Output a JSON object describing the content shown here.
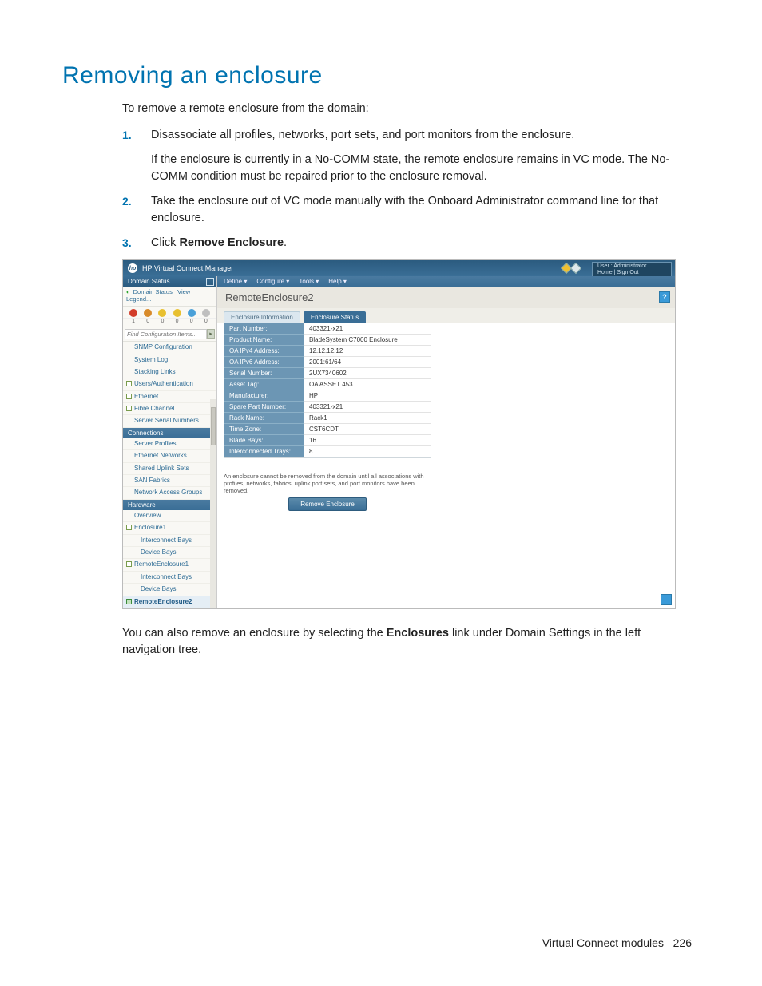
{
  "title": "Removing an enclosure",
  "intro": "To remove a remote enclosure from the domain:",
  "steps": {
    "s1a": "Disassociate all profiles, networks, port sets, and port monitors from the enclosure.",
    "s1b": "If the enclosure is currently in a No-COMM state, the remote enclosure remains in VC mode. The No-COMM condition must be repaired prior to the enclosure removal.",
    "s2": "Take the enclosure out of VC mode manually with the Onboard Administrator command line for that enclosure.",
    "s3_pre": "Click ",
    "s3_bold": "Remove Enclosure",
    "s3_post": "."
  },
  "after_pre": "You can also remove an enclosure by selecting the ",
  "after_bold": "Enclosures",
  "after_post": " link under Domain Settings in the left navigation tree.",
  "footer_label": "Virtual Connect modules",
  "footer_page": "226",
  "mock": {
    "topbar_title": "HP Virtual Connect Manager",
    "user_line1": "User : Administrator",
    "user_line2": "Home | Sign Out",
    "side": {
      "ds": "Domain Status",
      "legend1": "Domain Status",
      "legend2": "View Legend...",
      "counts": [
        "1",
        "0",
        "0",
        "0",
        "0",
        "0"
      ],
      "find_ph": "Find Configuration Items...",
      "items_top": [
        "SNMP Configuration",
        "System Log",
        "Stacking Links",
        "Users/Authentication",
        "Ethernet",
        "Fibre Channel",
        "Server Serial Numbers"
      ],
      "sect_conn": "Connections",
      "items_conn": [
        "Server Profiles",
        "Ethernet Networks",
        "Shared Uplink Sets",
        "SAN Fabrics",
        "Network Access Groups"
      ],
      "sect_hw": "Hardware",
      "items_hw": [
        "Overview",
        "Enclosure1",
        "Interconnect Bays",
        "Device Bays",
        "RemoteEnclosure1",
        "Interconnect Bays",
        "Device Bays",
        "RemoteEnclosure2"
      ]
    },
    "menus": [
      "Define ▾",
      "Configure ▾",
      "Tools ▾",
      "Help ▾"
    ],
    "heading": "RemoteEnclosure2",
    "tabs": {
      "t1": "Enclosure Information",
      "t2": "Enclosure Status"
    },
    "props": [
      {
        "k": "Part Number:",
        "v": "403321-x21"
      },
      {
        "k": "Product Name:",
        "v": "BladeSystem C7000 Enclosure"
      },
      {
        "k": "OA IPv4 Address:",
        "v": "12.12.12.12"
      },
      {
        "k": "OA IPv6 Address:",
        "v": "2001:61/64"
      },
      {
        "k": "Serial Number:",
        "v": "2UX7340602"
      },
      {
        "k": "Asset Tag:",
        "v": "OA ASSET 453"
      },
      {
        "k": "Manufacturer:",
        "v": "HP"
      },
      {
        "k": "Spare Part Number:",
        "v": "403321-x21"
      },
      {
        "k": "Rack Name:",
        "v": "Rack1"
      },
      {
        "k": "Time Zone:",
        "v": "CST6CDT"
      },
      {
        "k": "Blade Bays:",
        "v": "16"
      },
      {
        "k": "Interconnected Trays:",
        "v": "8"
      }
    ],
    "note": "An enclosure cannot be removed from the domain until all associations with profiles, networks, fabrics, uplink port sets, and port monitors have been removed.",
    "btn": "Remove Enclosure"
  }
}
